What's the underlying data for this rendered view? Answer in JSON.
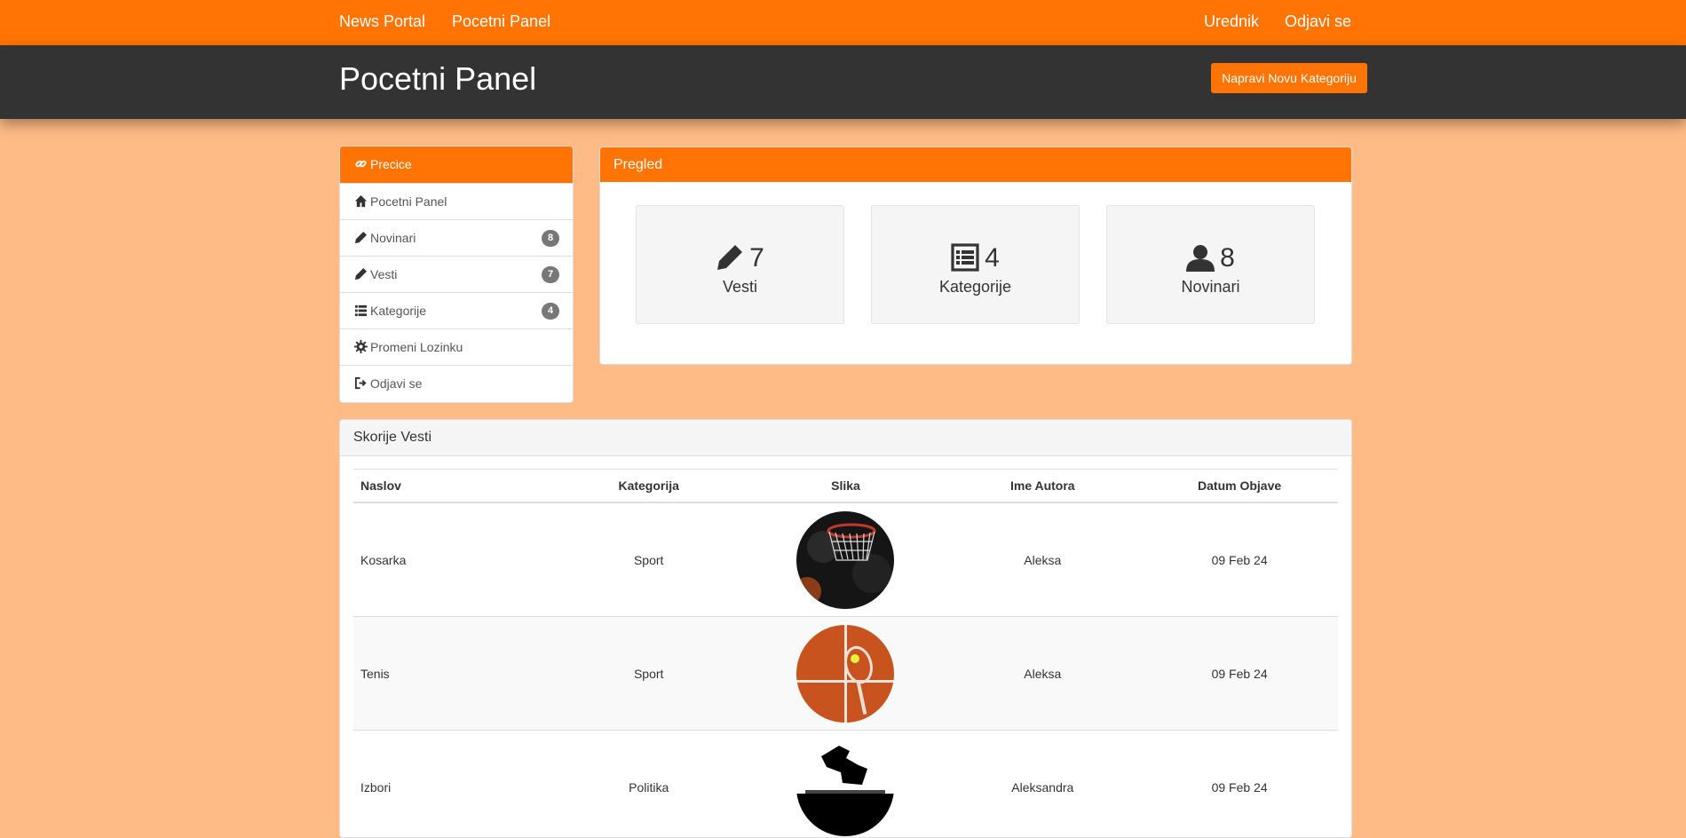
{
  "nav": {
    "brand": "News Portal",
    "home": "Pocetni Panel",
    "user": "Urednik",
    "logout": "Odjavi se"
  },
  "header": {
    "title": "Pocetni Panel",
    "new_category_button": "Napravi Novu Kategoriju"
  },
  "sidebar": {
    "title": "Precice",
    "items": [
      {
        "label": "Pocetni Panel",
        "icon": "home-icon"
      },
      {
        "label": "Novinari",
        "icon": "pencil-icon",
        "badge": "8"
      },
      {
        "label": "Vesti",
        "icon": "pencil-icon",
        "badge": "7"
      },
      {
        "label": "Kategorije",
        "icon": "list-icon",
        "badge": "4"
      },
      {
        "label": "Promeni Lozinku",
        "icon": "gear-icon"
      },
      {
        "label": "Odjavi se",
        "icon": "logout-icon"
      }
    ]
  },
  "overview": {
    "title": "Pregled",
    "stats": [
      {
        "value": "7",
        "label": "Vesti",
        "icon": "pencil-icon"
      },
      {
        "value": "4",
        "label": "Kategorije",
        "icon": "list-icon"
      },
      {
        "value": "8",
        "label": "Novinari",
        "icon": "user-icon"
      }
    ]
  },
  "recent": {
    "title": "Skorije Vesti",
    "columns": [
      "Naslov",
      "Kategorija",
      "Slika",
      "Ime Autora",
      "Datum Objave"
    ],
    "rows": [
      {
        "title": "Kosarka",
        "category": "Sport",
        "image": "basketball-image",
        "author": "Aleksa",
        "date": "09 Feb 24"
      },
      {
        "title": "Tenis",
        "category": "Sport",
        "image": "tennis-image",
        "author": "Aleksa",
        "date": "09 Feb 24"
      },
      {
        "title": "Izbori",
        "category": "Politika",
        "image": "ballot-image",
        "author": "Aleksandra",
        "date": "09 Feb 24"
      }
    ]
  },
  "colors": {
    "accent": "#ff7404",
    "header": "#333333",
    "background": "#ffbb85"
  }
}
